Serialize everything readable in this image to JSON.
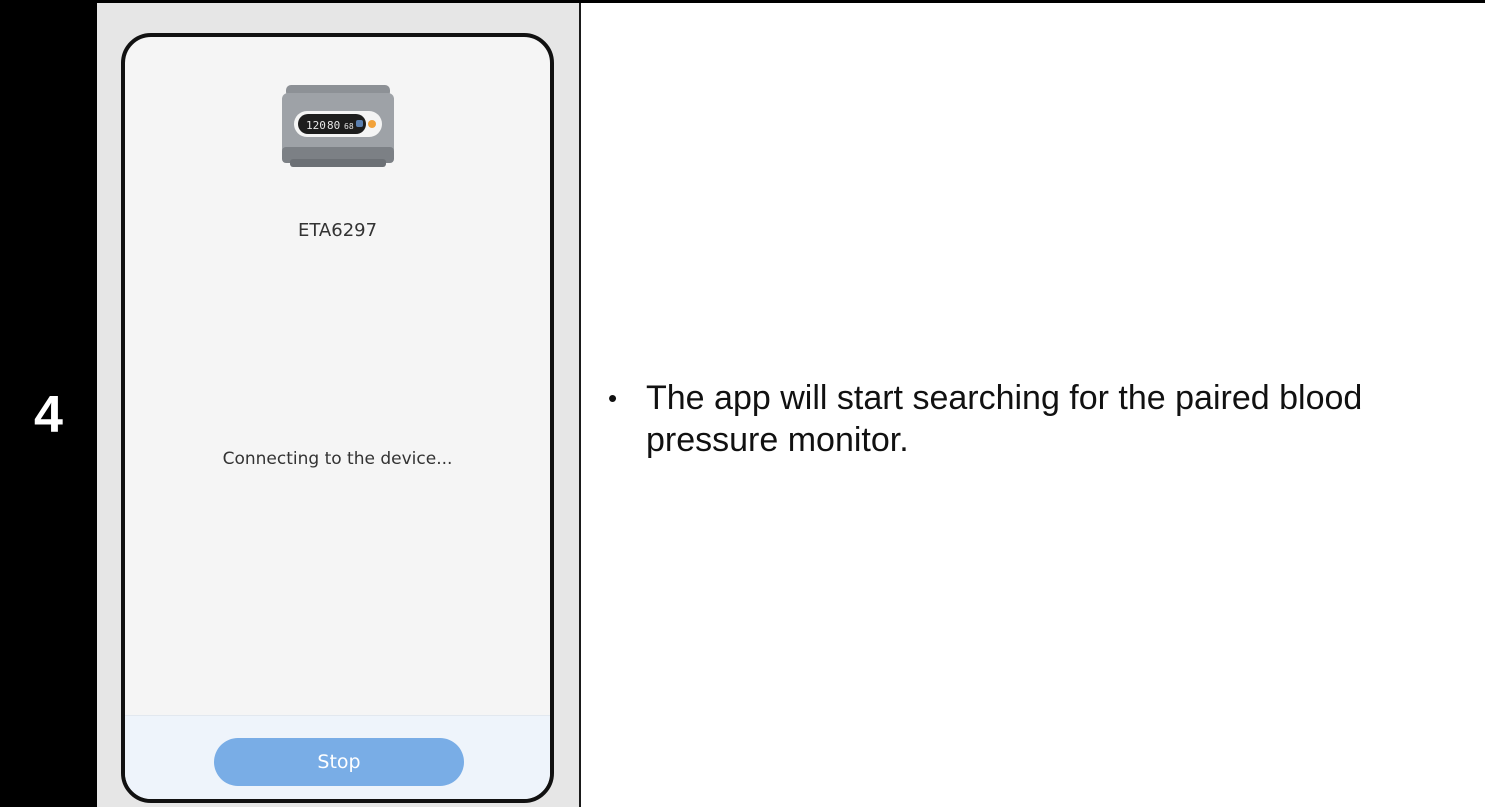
{
  "step": {
    "number": "4"
  },
  "phone": {
    "device_name": "ETA6297",
    "status": "Connecting to the device...",
    "stop_label": "Stop",
    "device_display": {
      "sys": "120",
      "dia": "80",
      "pulse": "68"
    }
  },
  "instruction": {
    "bullet": "•",
    "text": "The app will start searching for the paired blood pressure monitor."
  },
  "colors": {
    "step_background": "#000000",
    "phone_background": "#f5f5f5",
    "stop_button": "#79ade6"
  },
  "icons": {
    "device": "blood-pressure-monitor-image"
  }
}
